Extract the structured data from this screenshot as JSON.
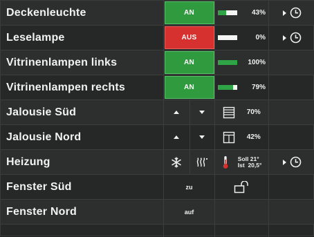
{
  "rows": [
    {
      "name": "Deckenleuchte",
      "state": "AN",
      "percent_label": "43%",
      "level": 0.43,
      "timer_icon": "clock-icon"
    },
    {
      "name": "Leselampe",
      "state": "AUS",
      "percent_label": "0%",
      "level": 0.0,
      "timer_icon": "clock-icon"
    },
    {
      "name": "Vitrinenlampen links",
      "state": "AN",
      "percent_label": "100%",
      "level": 1.0
    },
    {
      "name": "Vitrinenlampen rechts",
      "state": "AN",
      "percent_label": "79%",
      "level": 0.79
    },
    {
      "name": "Jalousie Süd",
      "up_icon": "arrow-up-icon",
      "down_icon": "arrow-down-icon",
      "position_label": "70%",
      "blind_icon": "blind-closed-icon"
    },
    {
      "name": "Jalousie Nord",
      "up_icon": "arrow-up-icon",
      "down_icon": "arrow-down-icon",
      "position_label": "42%",
      "blind_icon": "blind-open-icon"
    },
    {
      "name": "Heizung",
      "mode_icons": [
        "snowflake-icon",
        "heat-waves-icon"
      ],
      "soll_label": "Soll 21°",
      "ist_label": "Ist  20,5°",
      "timer_icon": "clock-icon"
    },
    {
      "name": "Fenster Süd",
      "state": "zu",
      "lock_icon": "padlock-open-icon"
    },
    {
      "name": "Fenster Nord",
      "state": "auf"
    }
  ],
  "colors": {
    "on": "#2f9a3e",
    "off": "#d6302f",
    "bar_fill": "#2ea447",
    "background": "#262727"
  }
}
